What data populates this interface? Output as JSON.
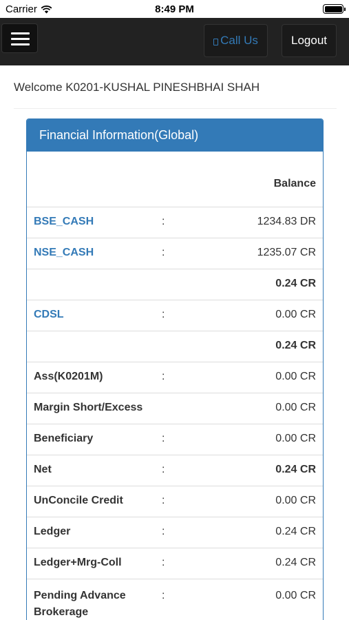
{
  "status_bar": {
    "carrier": "Carrier",
    "time": "8:49 PM"
  },
  "navbar": {
    "call_label": "Call Us",
    "logout_label": "Logout"
  },
  "welcome_text": "Welcome K0201-KUSHAL PINESHBHAI SHAH",
  "panel": {
    "title": "Financial Information(Global)",
    "balance_header": "Balance",
    "rows": [
      {
        "label": "BSE_CASH",
        "colon": ":",
        "value": "1234.83 DR",
        "link": true,
        "bold_value": false
      },
      {
        "label": "NSE_CASH",
        "colon": ":",
        "value": "1235.07 CR",
        "link": true,
        "bold_value": false
      },
      {
        "label": "",
        "colon": "",
        "value": "0.24 CR",
        "link": false,
        "bold_value": true
      },
      {
        "label": "CDSL",
        "colon": ":",
        "value": "0.00 CR",
        "link": true,
        "bold_value": false
      },
      {
        "label": "",
        "colon": "",
        "value": "0.24 CR",
        "link": false,
        "bold_value": true
      },
      {
        "label": "Ass(K0201M)",
        "colon": ":",
        "value": "0.00 CR",
        "link": false,
        "bold_value": false
      },
      {
        "label": "Margin Short/Excess",
        "colon": "",
        "value": "0.00 CR",
        "link": false,
        "bold_value": false
      },
      {
        "label": "Beneficiary",
        "colon": ":",
        "value": "0.00 CR",
        "link": false,
        "bold_value": false
      },
      {
        "label": "Net",
        "colon": ":",
        "value": "0.24 CR",
        "link": false,
        "bold_value": true
      },
      {
        "label": "UnConcile Credit",
        "colon": ":",
        "value": "0.00 CR",
        "link": false,
        "bold_value": false
      },
      {
        "label": "Ledger",
        "colon": ":",
        "value": "0.24 CR",
        "link": false,
        "bold_value": false
      },
      {
        "label": "Ledger+Mrg-Coll",
        "colon": ":",
        "value": "0.24 CR",
        "link": false,
        "bold_value": false
      },
      {
        "label": "Pending Advance Brokerage",
        "colon": ":",
        "value": "0.00 CR",
        "link": false,
        "bold_value": false
      }
    ]
  },
  "colors": {
    "navbar_bg": "#222222",
    "primary": "#337ab7",
    "text": "#333333"
  }
}
